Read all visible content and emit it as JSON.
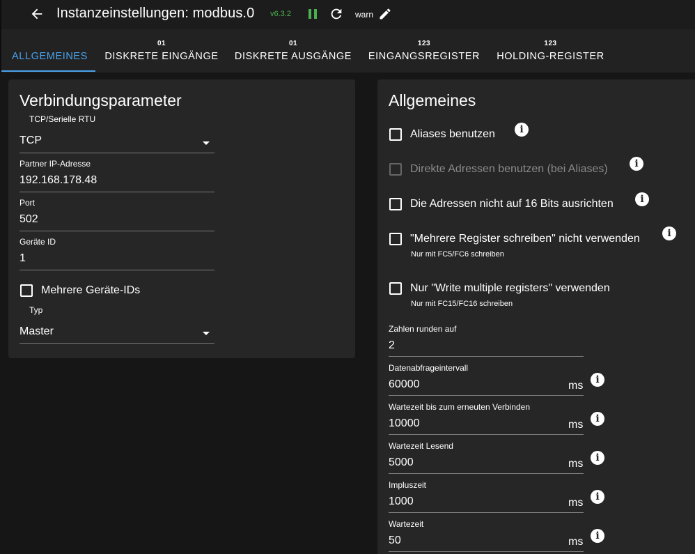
{
  "header": {
    "title": "Instanzeinstellungen: modbus.0",
    "version": "v6.3.2",
    "loglevel": "warn",
    "icons": [
      "arrow-back-icon",
      "pause-icon",
      "refresh-icon",
      "pencil-icon"
    ],
    "colors": {
      "version": "#4caf50",
      "pause": "#4caf50"
    }
  },
  "tabs": [
    {
      "badge": "",
      "label": "ALLGEMEINES",
      "active": true
    },
    {
      "badge": "01",
      "label": "DISKRETE EINGÄNGE",
      "active": false
    },
    {
      "badge": "01",
      "label": "DISKRETE AUSGÄNGE",
      "active": false
    },
    {
      "badge": "123",
      "label": "EINGANGSREGISTER",
      "active": false
    },
    {
      "badge": "123",
      "label": "HOLDING-REGISTER",
      "active": false
    }
  ],
  "connection": {
    "title": "Verbindungsparameter",
    "type": {
      "label": "TCP/Serielle RTU",
      "value": "TCP"
    },
    "ip": {
      "label": "Partner IP-Adresse",
      "value": "192.168.178.48"
    },
    "port": {
      "label": "Port",
      "value": "502"
    },
    "device_id": {
      "label": "Geräte ID",
      "value": "1"
    },
    "multi_ids": {
      "label": "Mehrere Geräte-IDs",
      "checked": false
    },
    "role": {
      "label": "Typ",
      "value": "Master"
    }
  },
  "general": {
    "title": "Allgemeines",
    "checkboxes": [
      {
        "label": "Aliases benutzen",
        "checked": false,
        "disabled": false,
        "helper": ""
      },
      {
        "label": "Direkte Adressen benutzen (bei Aliases)",
        "checked": false,
        "disabled": true,
        "helper": ""
      },
      {
        "label": "Die Adressen nicht auf 16 Bits ausrichten",
        "checked": false,
        "disabled": false,
        "helper": ""
      },
      {
        "label": "\"Mehrere Register schreiben\" nicht verwenden",
        "checked": false,
        "disabled": false,
        "helper": "Nur mit FC5/FC6 schreiben"
      },
      {
        "label": "Nur \"Write multiple registers\" verwenden",
        "checked": false,
        "disabled": false,
        "helper": "Nur mit FC15/FC16 schreiben"
      }
    ],
    "round": {
      "label": "Zahlen runden auf",
      "value": "2"
    },
    "poll": {
      "label": "Datenabfrageintervall",
      "value": "60000",
      "unit": "ms"
    },
    "reconnect": {
      "label": "Wartezeit bis zum erneuten Verbinden",
      "value": "10000",
      "unit": "ms"
    },
    "read_timeout": {
      "label": "Wartezeit Lesend",
      "value": "5000",
      "unit": "ms"
    },
    "pulse": {
      "label": "Impluszeit",
      "value": "1000",
      "unit": "ms"
    },
    "wait": {
      "label": "Wartezeit",
      "value": "50",
      "unit": "ms"
    }
  }
}
